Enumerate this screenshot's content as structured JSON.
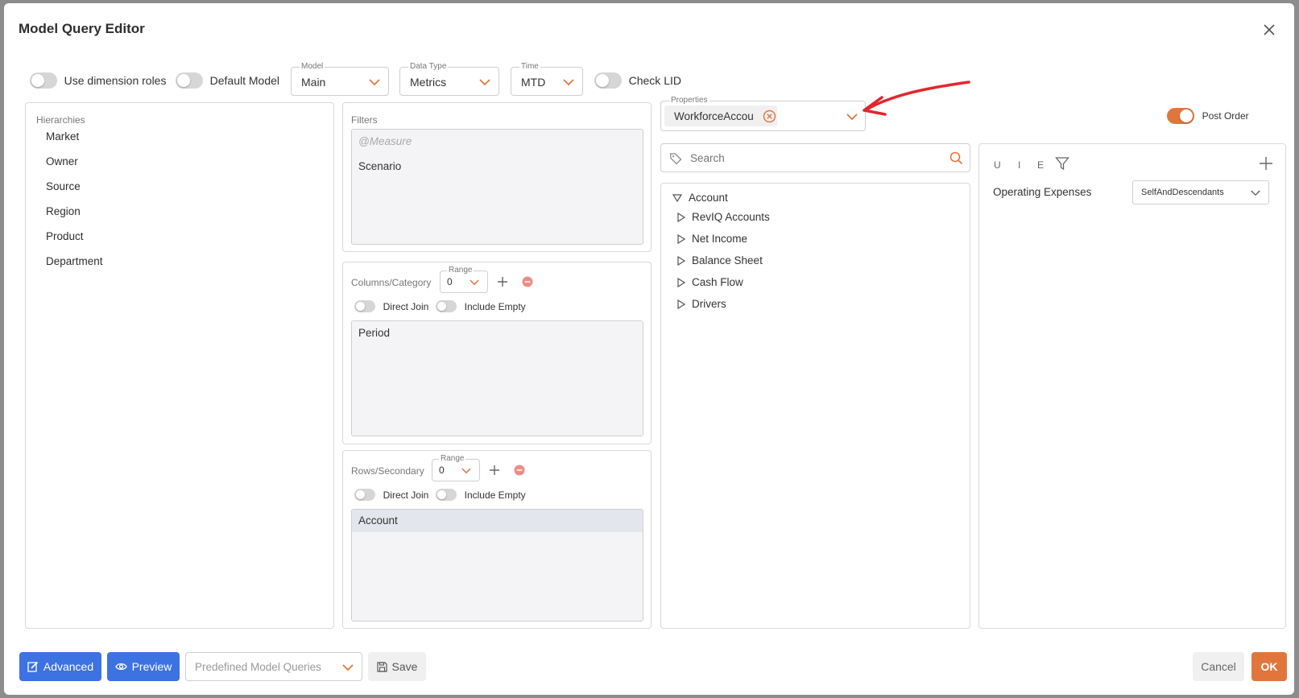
{
  "dialog": {
    "title": "Model Query Editor"
  },
  "toolbar": {
    "use_dimension_roles": "Use dimension roles",
    "default_model": "Default Model",
    "model": {
      "legend": "Model",
      "value": "Main"
    },
    "data_type": {
      "legend": "Data Type",
      "value": "Metrics"
    },
    "time": {
      "legend": "Time",
      "value": "MTD"
    },
    "check_lid": "Check LID"
  },
  "hierarchies": {
    "title": "Hierarchies",
    "items": [
      "Market",
      "Owner",
      "Source",
      "Region",
      "Product",
      "Department"
    ]
  },
  "filters": {
    "title": "Filters",
    "items": [
      "@Measure",
      "Scenario"
    ]
  },
  "columns": {
    "title": "Columns/Category",
    "range_legend": "Range",
    "range_value": "0",
    "direct_join": "Direct Join",
    "include_empty": "Include Empty",
    "items": [
      "Period"
    ]
  },
  "rows": {
    "title": "Rows/Secondary",
    "range_legend": "Range",
    "range_value": "0",
    "direct_join": "Direct Join",
    "include_empty": "Include Empty",
    "items": [
      "Account"
    ]
  },
  "properties": {
    "legend": "Properties",
    "chip": "WorkforceAccou",
    "post_order": "Post Order"
  },
  "search": {
    "placeholder": "Search"
  },
  "tree": {
    "root": "Account",
    "children": [
      "RevIQ Accounts",
      "Net Income",
      "Balance Sheet",
      "Cash Flow",
      "Drivers"
    ]
  },
  "selection": {
    "tabs": [
      "U",
      "I",
      "E"
    ],
    "row": {
      "label": "Operating Expenses",
      "function": "SelfAndDescendants"
    }
  },
  "footer": {
    "advanced": "Advanced",
    "preview": "Preview",
    "predefined": "Predefined Model Queries",
    "save": "Save",
    "cancel": "Cancel",
    "ok": "OK"
  },
  "colors": {
    "accent": "#e1763d",
    "primary": "#3d72e3",
    "annotation": "#e3262d"
  }
}
